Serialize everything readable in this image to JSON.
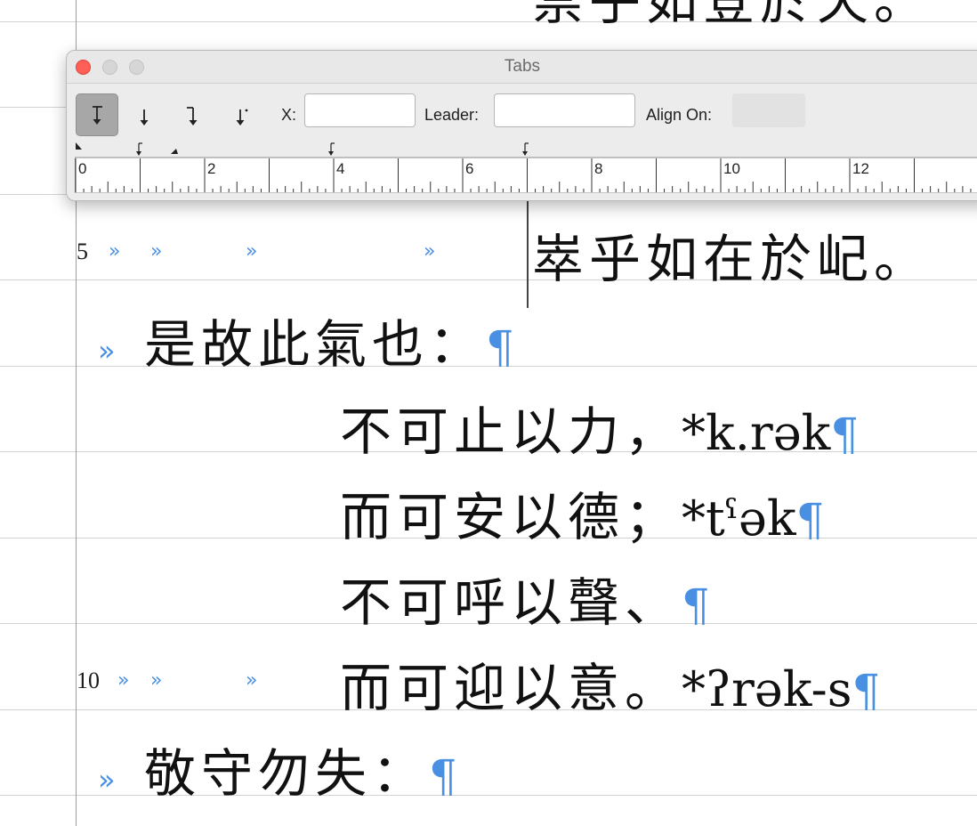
{
  "palette": {
    "title": "Tabs",
    "x_label": "X:",
    "x_value": "",
    "leader_label": "Leader:",
    "leader_value": "",
    "align_label": "Align On:",
    "align_value": "",
    "tab_types": [
      "left-tab",
      "center-tab",
      "right-tab",
      "decimal-tab"
    ],
    "selected_tab_type": "left-tab",
    "ruler_labels": [
      "0",
      "2",
      "4",
      "6",
      "8",
      "10",
      "12"
    ]
  },
  "document": {
    "lines": [
      {
        "id": "top",
        "text": "崇乎如登於天。"
      },
      {
        "id": "l5",
        "line_number": "5",
        "text": "崒乎如在於屺。"
      },
      {
        "id": "l6",
        "text": "是故此氣也：",
        "pilcrow": "¶"
      },
      {
        "id": "l7",
        "text": "不可止以力，",
        "ipa": "*k.rək",
        "pilcrow": "¶"
      },
      {
        "id": "l8",
        "text": "而可安以德；",
        "ipa": "*tˤək",
        "pilcrow": "¶"
      },
      {
        "id": "l9",
        "text": "不可呼以聲、",
        "pilcrow": "¶"
      },
      {
        "id": "l10",
        "line_number": "10",
        "text": "而可迎以意。",
        "ipa": "*ʔrək-s",
        "pilcrow": "¶"
      },
      {
        "id": "l11",
        "text": "敬守勿失：",
        "pilcrow": "¶"
      }
    ],
    "tab_glyph": "»"
  },
  "colors": {
    "invisibles": "#4a90e2",
    "margin_rule": "#8f97e3",
    "close_button": "#fe5f57"
  }
}
